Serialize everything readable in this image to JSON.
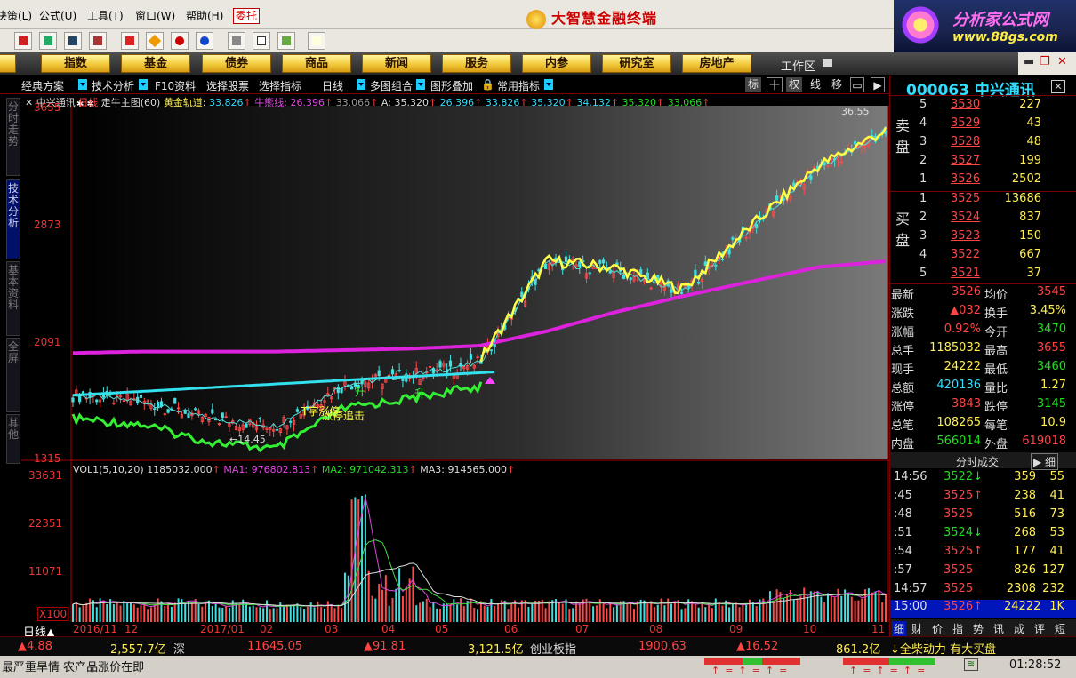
{
  "menu": [
    "决策(L)",
    "公式(U)",
    "工具(T)",
    "窗口(W)",
    "帮助(H)"
  ],
  "weituo": "委托",
  "brand": "大智慧金融终端",
  "promo": {
    "line1": "分析家公式网",
    "line2": "www.88gs.com"
  },
  "categories": [
    "股",
    "指数",
    "基金",
    "债券",
    "商品",
    "新闻",
    "服务",
    "内参",
    "研究室",
    "房地产"
  ],
  "workarea": "工作区",
  "tabs": {
    "classic": "经典方案",
    "tech": "技术分析",
    "f10": "F10资料",
    "pick": "选择股票",
    "indicator": "选择指标",
    "period": "日线",
    "multi": "多图组合",
    "overlay": "图形叠加",
    "common": "常用指标"
  },
  "toggles": [
    "标",
    "十",
    "权",
    "线",
    "移"
  ],
  "sidetabs": [
    "分时走势",
    "技术分析",
    "基本资料",
    "全屏",
    "其他"
  ],
  "legend": {
    "name": "中兴通讯",
    "period": "日线",
    "main": "走牛主图(60)",
    "gold_label": "黄金轨道:",
    "gold_val": "33.826",
    "bull_label": "牛熊线:",
    "bull_val": "26.396",
    "v1": "33.066",
    "a_label": "A:",
    "a_val": "35.320",
    "v2": "26.396",
    "v3": "33.826",
    "v4": "35.320",
    "v5": "34.132",
    "v6": "35.320",
    "v7": "33.066"
  },
  "price_axis": [
    "3655",
    "2873",
    "2091",
    "1315"
  ],
  "annotations": {
    "peak": "36.55",
    "low": "←14.45",
    "tzi": "T字涨停",
    "zhangting": "涨停追击",
    "sheng1": "升",
    "sheng2": "升"
  },
  "vol_legend": {
    "name": "VOL1(5,10,20)",
    "vol": "1185032.000",
    "ma1_label": "MA1:",
    "ma1": "976802.813",
    "ma2_label": "MA2:",
    "ma2": "971042.313",
    "ma3_label": "MA3:",
    "ma3": "914565.000"
  },
  "vol_axis": [
    "33631",
    "22351",
    "11071",
    "X100"
  ],
  "period_tag": "日线▲",
  "dates": [
    "2016/11",
    "12",
    "2017/01",
    "02",
    "03",
    "04",
    "05",
    "06",
    "07",
    "08",
    "09",
    "10",
    "11"
  ],
  "quote": {
    "code": "000063",
    "name": "中兴通讯"
  },
  "sell": [
    {
      "lv": "5",
      "p": "3530",
      "v": "227"
    },
    {
      "lv": "4",
      "p": "3529",
      "v": "43"
    },
    {
      "lv": "3",
      "p": "3528",
      "v": "48"
    },
    {
      "lv": "2",
      "p": "3527",
      "v": "199"
    },
    {
      "lv": "1",
      "p": "3526",
      "v": "2502"
    }
  ],
  "buy": [
    {
      "lv": "1",
      "p": "3525",
      "v": "13686"
    },
    {
      "lv": "2",
      "p": "3524",
      "v": "837"
    },
    {
      "lv": "3",
      "p": "3523",
      "v": "150"
    },
    {
      "lv": "4",
      "p": "3522",
      "v": "667"
    },
    {
      "lv": "5",
      "p": "3521",
      "v": "37"
    }
  ],
  "sell_label": [
    "卖",
    "盘"
  ],
  "buy_label": [
    "买",
    "盘"
  ],
  "stats": [
    {
      "k": "最新",
      "v": "3526",
      "k2": "均价",
      "v2": "3545"
    },
    {
      "k": "涨跌",
      "v": "▲032",
      "k2": "换手",
      "v2": "3.45%"
    },
    {
      "k": "涨幅",
      "v": "0.92%",
      "k2": "今开",
      "v2": "3470"
    },
    {
      "k": "总手",
      "v": "1185032",
      "k2": "最高",
      "v2": "3655"
    },
    {
      "k": "现手",
      "v": "24222",
      "k2": "最低",
      "v2": "3460"
    },
    {
      "k": "总额",
      "v": "420136",
      "k2": "量比",
      "v2": "1.27"
    },
    {
      "k": "涨停",
      "v": "3843",
      "k2": "跌停",
      "v2": "3145"
    },
    {
      "k": "总笔",
      "v": "108265",
      "k2": "每笔",
      "v2": "10.9"
    },
    {
      "k": "内盘",
      "v": "566014",
      "k2": "外盘",
      "v2": "619018"
    }
  ],
  "ticks_header": "分时成交",
  "ticks_btn": "细",
  "ticks": [
    {
      "t": "14:56",
      "p": "3522↓",
      "v": "359",
      "n": "55"
    },
    {
      "t": ":45",
      "p": "3525↑",
      "v": "238",
      "n": "41"
    },
    {
      "t": ":48",
      "p": "3525",
      "v": "516",
      "n": "73"
    },
    {
      "t": ":51",
      "p": "3524↓",
      "v": "268",
      "n": "53"
    },
    {
      "t": ":54",
      "p": "3525↑",
      "v": "177",
      "n": "41"
    },
    {
      "t": ":57",
      "p": "3525",
      "v": "826",
      "n": "127"
    },
    {
      "t": "14:57",
      "p": "3525",
      "v": "2308",
      "n": "232"
    },
    {
      "t": "15:00",
      "p": "3526↑",
      "v": "24222",
      "n": "1K"
    }
  ],
  "rtabs": [
    "细",
    "财",
    "价",
    "指",
    "势",
    "讯",
    "成",
    "评",
    "短"
  ],
  "status": {
    "a": "▲4.88",
    "b": "2,557.7亿",
    "c": "深",
    "d": "11645.05",
    "e": "▲91.81",
    "f": "3,121.5亿",
    "g": "创业板指",
    "h": "1900.63",
    "i": "▲16.52",
    "j": "861.2亿",
    "k": "↓全柴动力 有大买盘"
  },
  "news": "最严重旱情 农产品涨价在即",
  "clock": "01:28:52",
  "chart_data": {
    "type": "line",
    "title": "中兴通讯 日线 走牛主图(60)",
    "x": [
      "2016/11",
      "12",
      "2017/01",
      "02",
      "03",
      "04",
      "05",
      "06",
      "07",
      "08",
      "09",
      "10",
      "11"
    ],
    "ylim": [
      13.15,
      36.55
    ],
    "series": [
      {
        "name": "K线收盘",
        "values": [
          17.2,
          16.8,
          15.6,
          15.1,
          17.9,
          18.6,
          19.4,
          26.3,
          25.8,
          24.3,
          28.6,
          32.8,
          35.26
        ]
      },
      {
        "name": "黄金轨道",
        "values": [
          17.2,
          17.4,
          17.5,
          17.5,
          17.6,
          17.9,
          18.3,
          20.4,
          22.6,
          22.7,
          25.0,
          29.4,
          33.83
        ]
      },
      {
        "name": "牛熊线",
        "values": [
          20.1,
          20.2,
          20.2,
          20.2,
          20.3,
          20.4,
          20.6,
          21.6,
          22.9,
          24.0,
          25.0,
          26.0,
          26.4
        ]
      }
    ],
    "volume": {
      "name": "VOL1(5,10,20)",
      "ylim": [
        0,
        33631
      ],
      "unit": "X100"
    }
  }
}
